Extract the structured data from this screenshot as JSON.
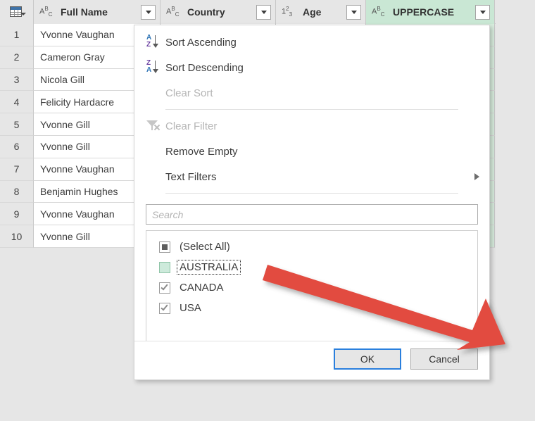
{
  "grid": {
    "corner_icon": "table-icon",
    "columns": [
      {
        "name": "Full Name",
        "type_icon": "text-type-icon",
        "type_label": "ABC",
        "selected": false
      },
      {
        "name": "Country",
        "type_icon": "text-type-icon",
        "type_label": "ABC",
        "selected": false
      },
      {
        "name": "Age",
        "type_icon": "number-type-icon",
        "type_label": "123",
        "selected": false
      },
      {
        "name": "UPPERCASE",
        "type_icon": "text-type-icon",
        "type_label": "ABC",
        "selected": true
      }
    ],
    "rows": [
      {
        "num": "1",
        "full_name": "Yvonne Vaughan"
      },
      {
        "num": "2",
        "full_name": "Cameron Gray"
      },
      {
        "num": "3",
        "full_name": "Nicola Gill"
      },
      {
        "num": "4",
        "full_name": "Felicity Hardacre"
      },
      {
        "num": "5",
        "full_name": "Yvonne Gill"
      },
      {
        "num": "6",
        "full_name": "Yvonne Gill"
      },
      {
        "num": "7",
        "full_name": "Yvonne Vaughan"
      },
      {
        "num": "8",
        "full_name": "Benjamin Hughes"
      },
      {
        "num": "9",
        "full_name": "Yvonne Vaughan"
      },
      {
        "num": "10",
        "full_name": "Yvonne Gill"
      }
    ]
  },
  "dropdown": {
    "menu_items": [
      {
        "label": "Sort Ascending",
        "icon": "sort-ascending-icon",
        "disabled": false,
        "submenu": false
      },
      {
        "label": "Sort Descending",
        "icon": "sort-descending-icon",
        "disabled": false,
        "submenu": false
      },
      {
        "label": "Clear Sort",
        "icon": "none",
        "disabled": true,
        "submenu": false
      },
      {
        "label": "Clear Filter",
        "icon": "clear-filter-icon",
        "disabled": true,
        "submenu": false
      },
      {
        "label": "Remove Empty",
        "icon": "none",
        "disabled": false,
        "submenu": false
      },
      {
        "label": "Text Filters",
        "icon": "none",
        "disabled": false,
        "submenu": true
      }
    ],
    "search": {
      "placeholder": "Search",
      "value": ""
    },
    "values": [
      {
        "label": "(Select All)",
        "state": "indeterminate",
        "focused": false,
        "highlight": false
      },
      {
        "label": "AUSTRALIA",
        "state": "unchecked",
        "focused": true,
        "highlight": true
      },
      {
        "label": "CANADA",
        "state": "checked",
        "focused": false,
        "highlight": false
      },
      {
        "label": "USA",
        "state": "checked",
        "focused": false,
        "highlight": false
      }
    ],
    "buttons": {
      "ok": "OK",
      "cancel": "Cancel"
    }
  },
  "annotation": {
    "arrow_color": "#e24b3f",
    "arrow_name": "red-pointer-arrow"
  },
  "colors": {
    "selected_column": "#c9e7d4",
    "focus_blue": "#2a7fdd",
    "background": "#e6e6e6"
  }
}
